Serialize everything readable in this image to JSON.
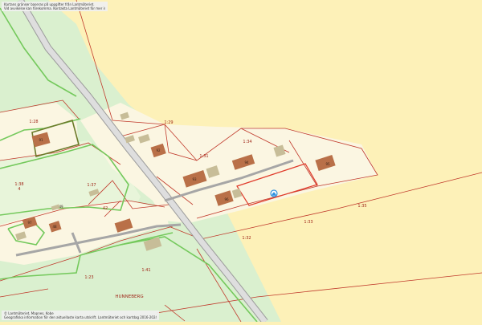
{
  "colors": {
    "background": "#fdf1b8",
    "property": "#fbf6e2",
    "forest": "#daf0cf",
    "forest_dark": "#c9e6bd",
    "boundary": "#c0392b",
    "green_border": "#74c95c",
    "olive_border": "#6b7b2a",
    "road": "#bcbcbc",
    "building": "#b97048",
    "outbuilding": "#c7bd98",
    "marker": "#2f93e0"
  },
  "notice": {
    "line1": "Kartans gränser baseras på uppgifter från Lantmäteriet.",
    "line2": "Vid avvikelse kan förekomma. Kontakta Lantmäteriet för mer information."
  },
  "credit": {
    "line1": "© Lantmäteriet, Mapnes, Kobe",
    "line2": "Geografiska information för den aktuellaste karta utskrift. Lantmäteriet och kartdag 2016-2024"
  },
  "parcels": [
    {
      "id": "p-1-28",
      "label": "1:28"
    },
    {
      "id": "p-1-29",
      "label": "1:29"
    },
    {
      "id": "p-1-31",
      "label": "1:31"
    },
    {
      "id": "p-1-34",
      "label": "1:34"
    },
    {
      "id": "p-1-38",
      "label": "1:38"
    },
    {
      "id": "p-4",
      "label": "4"
    },
    {
      "id": "p-1-37",
      "label": "1:37"
    },
    {
      "id": "p-1-35",
      "label": "1:35"
    },
    {
      "id": "p-1-33",
      "label": "1:33"
    },
    {
      "id": "p-1-32",
      "label": "1:32"
    },
    {
      "id": "p-1-23",
      "label": "1:23"
    },
    {
      "id": "p-1-41",
      "label": "1:41"
    },
    {
      "id": "p-42",
      "label": "42"
    }
  ],
  "place_name": "HUNNEBERG",
  "building_numbers": [
    "91",
    "92",
    "93",
    "94",
    "95",
    "96",
    "97",
    "48",
    "49",
    "42"
  ],
  "marker_icon": "house-marker-icon"
}
